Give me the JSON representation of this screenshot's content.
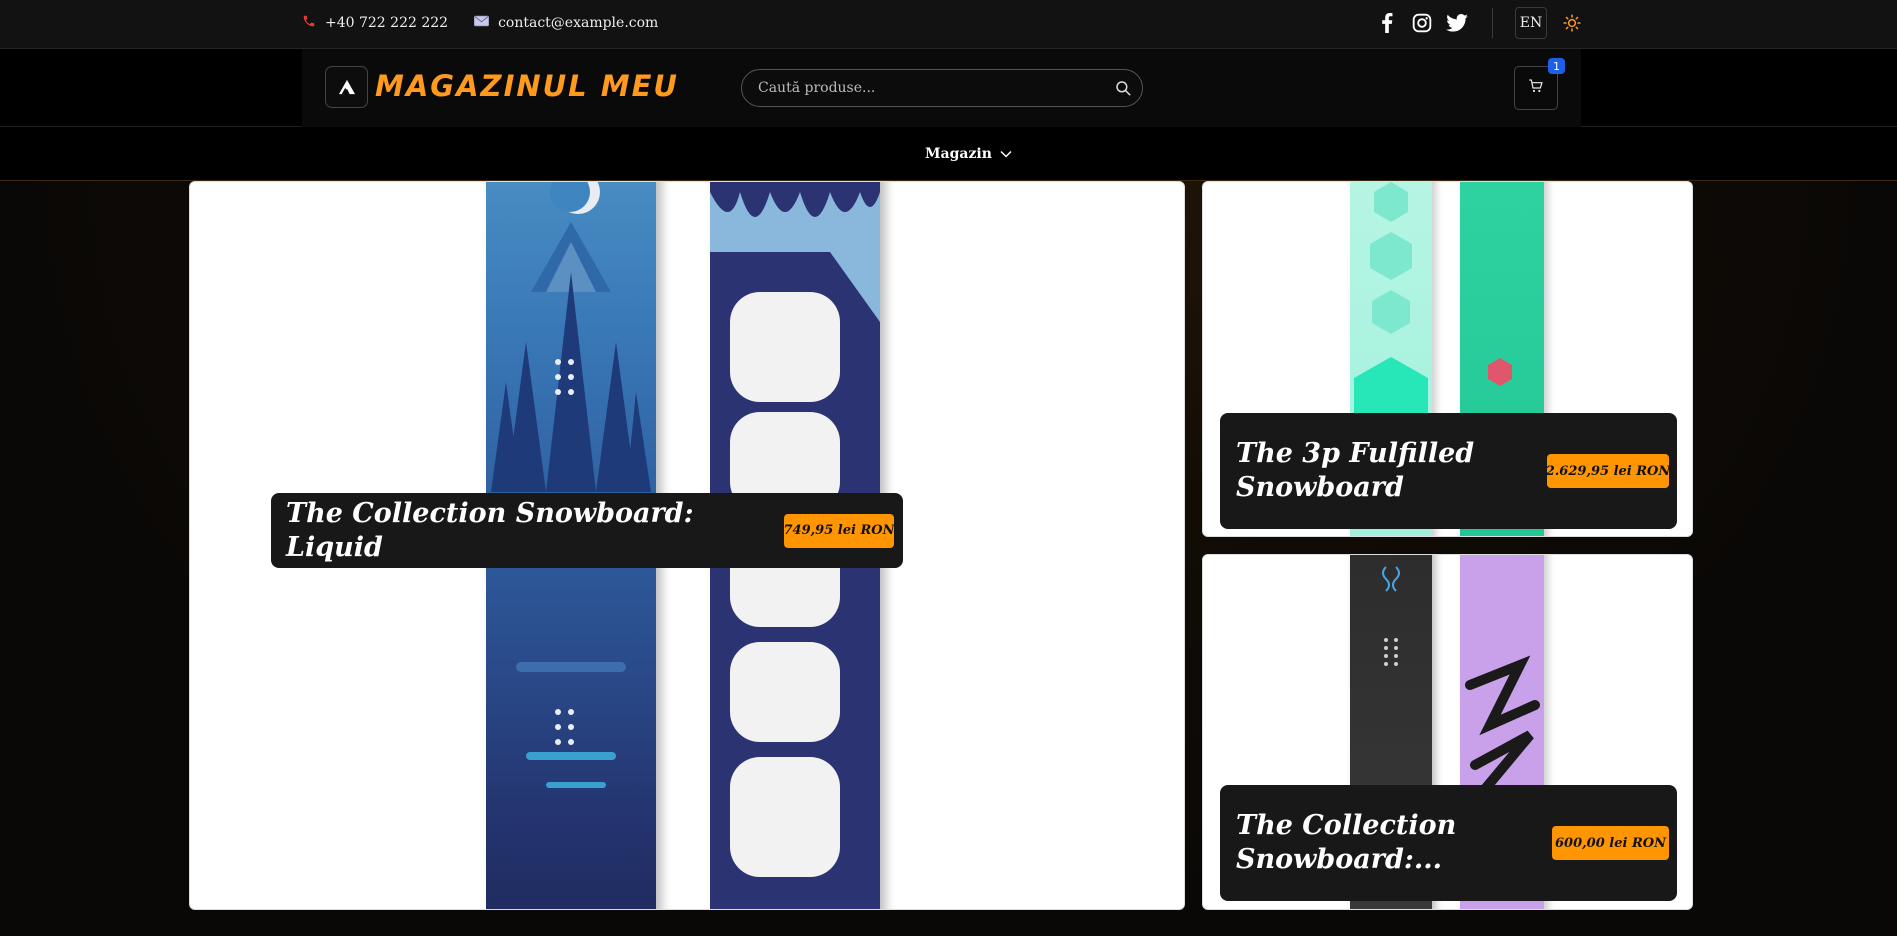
{
  "topbar": {
    "phone": "+40 722 222 222",
    "email": "contact@example.com",
    "language": "EN"
  },
  "header": {
    "store_name": "MAGAZINUL MEU",
    "search_placeholder": "Caută produse...",
    "cart_count": "1"
  },
  "nav": {
    "items": [
      {
        "label": "Magazin"
      }
    ]
  },
  "products": [
    {
      "title": "The Collection Snowboard: Liquid",
      "price": "749,95 lei RON"
    },
    {
      "title": "The 3p Fulfilled Snowboard",
      "price": "2.629,95 lei RON"
    },
    {
      "title": "The Collection Snowboard:...",
      "price": "600,00 lei RON"
    }
  ],
  "colors": {
    "accent": "#ff9500",
    "badge": "#1d5fe8",
    "background": "#0b0b0b"
  }
}
